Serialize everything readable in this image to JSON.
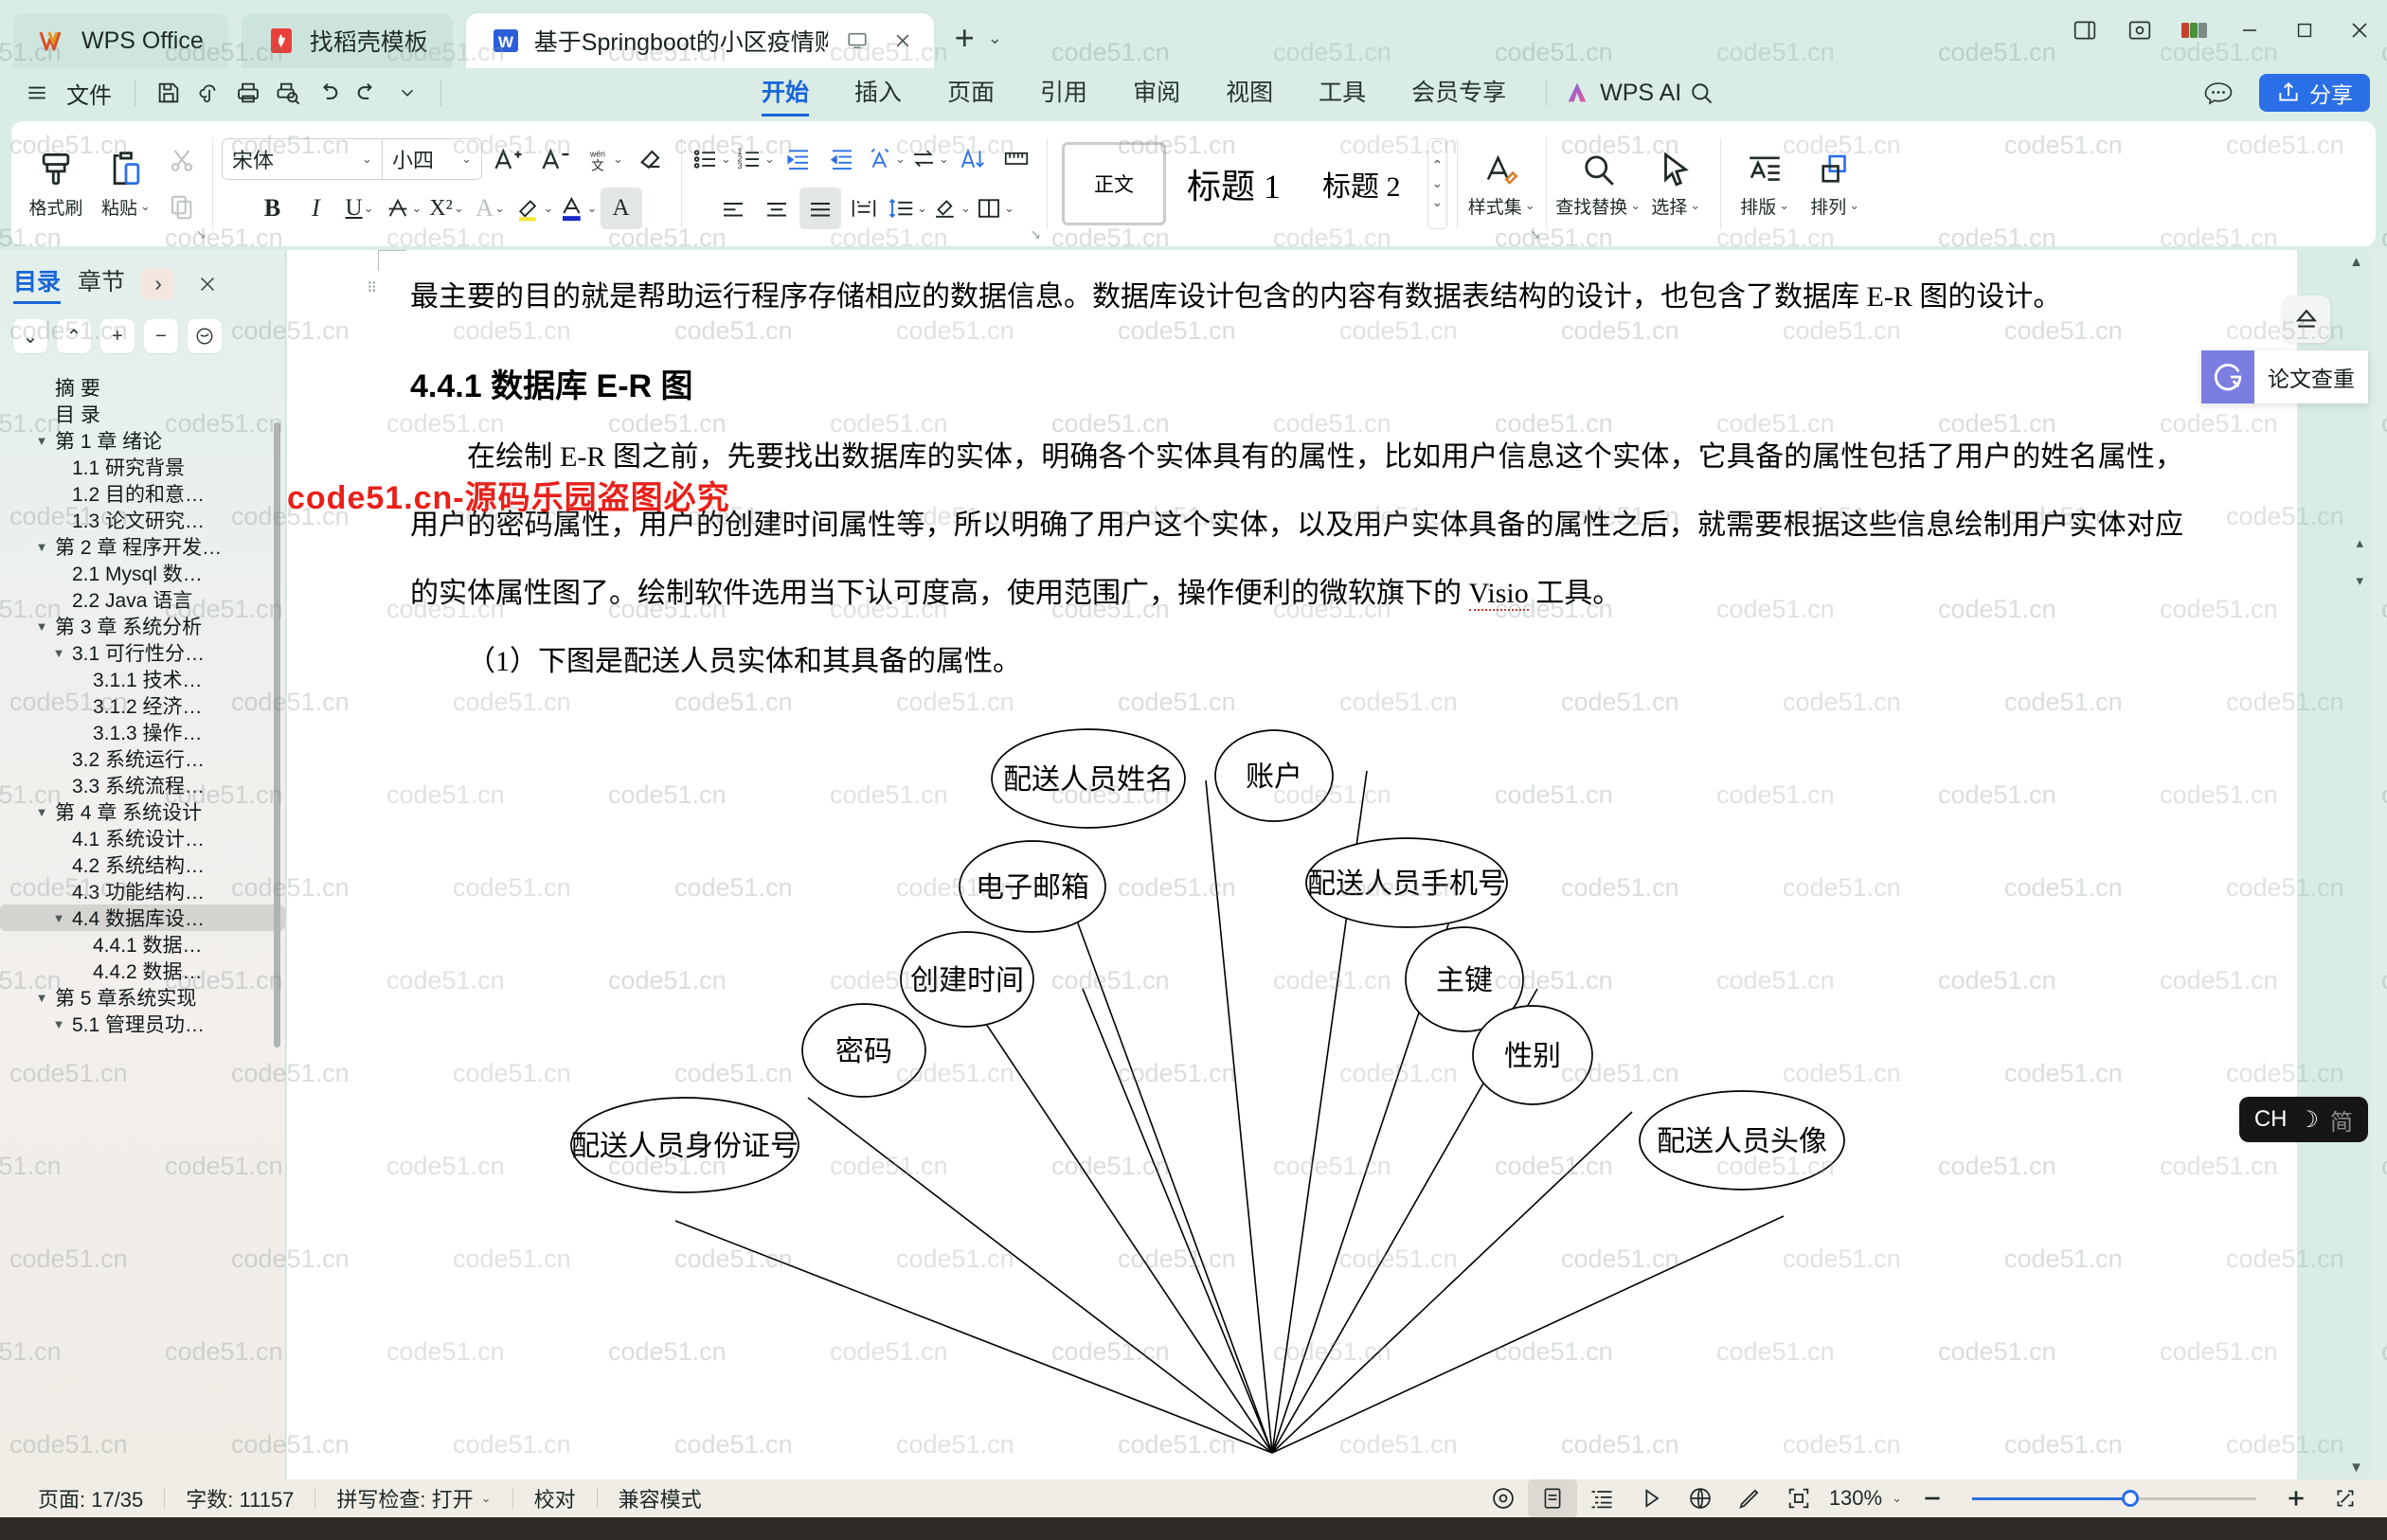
{
  "window": {
    "tabs": [
      {
        "name": "WPS Office",
        "icon": "wps-logo-icon"
      },
      {
        "name": "找稻壳模板",
        "icon": "docer-icon"
      },
      {
        "name": "基于Springboot的小区疫情购",
        "icon": "word-doc-icon"
      }
    ],
    "new_tab_icon": "plus-icon",
    "tab_list_icon": "chevron-down-icon",
    "controls": [
      "sidebar-toggle-icon",
      "focus-mode-icon",
      "layout-icon",
      "minimize-icon",
      "maximize-icon",
      "close-icon"
    ]
  },
  "quick_access": {
    "menu_label": "文件",
    "menu_icon": "hamburger-icon",
    "buttons": [
      "save-icon",
      "cloud-sync-icon",
      "print-icon",
      "print-preview-icon",
      "undo-icon",
      "redo-icon",
      "customize-caret-icon"
    ]
  },
  "ribbon": {
    "tabs": [
      "开始",
      "插入",
      "页面",
      "引用",
      "审阅",
      "视图",
      "工具",
      "会员专享"
    ],
    "active_tab": "开始",
    "ai_label": "WPS AI",
    "search_icon": "search-icon",
    "more_icon": "more-ellipsis-icon",
    "share_label": "分享",
    "share_icon": "share-arrow-icon",
    "groups": {
      "clipboard": {
        "format_painter": "格式刷",
        "paste": "粘贴",
        "cut_icon": "scissors-icon",
        "copy_icon": "copy-icon"
      },
      "font": {
        "font_name": "宋体",
        "font_size": "小四",
        "grow_icon": "increase-font-size-icon",
        "shrink_icon": "decrease-font-size-icon",
        "pinyin_icon": "pinyin-guide-icon",
        "clear_format_icon": "clear-formatting-icon",
        "bold": "B",
        "italic": "I",
        "underline": "U",
        "strikethrough_icon": "strikethrough-icon",
        "superscript": "X²",
        "text_effects_icon": "text-effects-icon",
        "highlight_icon": "highlight-color-icon",
        "font_color_icon": "font-color-icon",
        "char_shading_icon": "character-shading-icon"
      },
      "paragraph": {
        "bullets_icon": "bullet-list-icon",
        "numbering_icon": "numbered-list-icon",
        "decrease_indent_icon": "decrease-indent-icon",
        "increase_indent_icon": "increase-indent-icon",
        "paragraph_layout_icon": "paragraph-layout-icon",
        "text_direction_icon": "text-direction-icon",
        "sort_icon": "sort-icon",
        "show_marks_icon": "show-formatting-marks-icon",
        "align_left_icon": "align-left-icon",
        "align_center_icon": "align-center-icon",
        "align_right_icon": "align-right-icon",
        "justify_icon": "justify-icon",
        "distribute_icon": "distribute-icon",
        "line_spacing_icon": "line-spacing-icon",
        "shading_icon": "paragraph-shading-icon",
        "borders_icon": "borders-icon"
      },
      "styles": {
        "items": [
          "正文",
          "标题 1",
          "标题 2"
        ],
        "selected": "正文",
        "scroll_up_icon": "scroll-up-icon",
        "scroll_down_icon": "scroll-down-icon",
        "expand_icon": "expand-gallery-icon",
        "style_set_label": "样式集",
        "style_set_icon": "style-set-icon"
      },
      "editing": {
        "find_replace_label": "查找替换",
        "find_replace_icon": "search-icon",
        "select_label": "选择",
        "select_icon": "cursor-arrow-icon"
      },
      "arrange": {
        "typeset_label": "排版",
        "typeset_icon": "typeset-icon",
        "arrange_label": "排列",
        "arrange_icon": "arrange-shapes-icon"
      }
    }
  },
  "sidebar": {
    "tabs": [
      "目录",
      "章节"
    ],
    "active_tab": "目录",
    "expand_icon": "chevron-right-icon",
    "close_icon": "close-icon",
    "tools": [
      "collapse-down-icon",
      "collapse-up-icon",
      "expand-all-icon",
      "collapse-all-icon",
      "settings-circle-icon"
    ],
    "toc": [
      {
        "label": "摘  要",
        "level": 0,
        "caret": "",
        "selected": false
      },
      {
        "label": "目  录",
        "level": 0,
        "caret": "",
        "selected": false
      },
      {
        "label": "第 1 章 绪论",
        "level": 0,
        "caret": "▼",
        "selected": false
      },
      {
        "label": "1.1 研究背景",
        "level": 1,
        "caret": "",
        "selected": false
      },
      {
        "label": "1.2 目的和意…",
        "level": 1,
        "caret": "",
        "selected": false
      },
      {
        "label": "1.3 论文研究…",
        "level": 1,
        "caret": "",
        "selected": false
      },
      {
        "label": "第 2 章 程序开发…",
        "level": 0,
        "caret": "▼",
        "selected": false
      },
      {
        "label": "2.1 Mysql 数…",
        "level": 1,
        "caret": "",
        "selected": false
      },
      {
        "label": "2.2 Java 语言",
        "level": 1,
        "caret": "",
        "selected": false
      },
      {
        "label": "第 3 章 系统分析",
        "level": 0,
        "caret": "▼",
        "selected": false
      },
      {
        "label": "3.1 可行性分…",
        "level": 1,
        "caret": "▼",
        "selected": false
      },
      {
        "label": "3.1.1 技术…",
        "level": 2,
        "caret": "",
        "selected": false
      },
      {
        "label": "3.1.2 经济…",
        "level": 2,
        "caret": "",
        "selected": false
      },
      {
        "label": "3.1.3 操作…",
        "level": 2,
        "caret": "",
        "selected": false
      },
      {
        "label": "3.2 系统运行…",
        "level": 1,
        "caret": "",
        "selected": false
      },
      {
        "label": "3.3 系统流程…",
        "level": 1,
        "caret": "",
        "selected": false
      },
      {
        "label": "第 4 章 系统设计",
        "level": 0,
        "caret": "▼",
        "selected": false
      },
      {
        "label": "4.1 系统设计…",
        "level": 1,
        "caret": "",
        "selected": false
      },
      {
        "label": "4.2 系统结构…",
        "level": 1,
        "caret": "",
        "selected": false
      },
      {
        "label": "4.3 功能结构…",
        "level": 1,
        "caret": "",
        "selected": false
      },
      {
        "label": "4.4 数据库设…",
        "level": 1,
        "caret": "▼",
        "selected": true
      },
      {
        "label": "4.4.1 数据…",
        "level": 2,
        "caret": "",
        "selected": false
      },
      {
        "label": "4.4.2 数据…",
        "level": 2,
        "caret": "",
        "selected": false
      },
      {
        "label": "第 5 章系统实现",
        "level": 0,
        "caret": "▼",
        "selected": false
      },
      {
        "label": "5.1 管理员功…",
        "level": 1,
        "caret": "▼",
        "selected": false
      }
    ]
  },
  "document": {
    "paragraphs": [
      "最主要的目的就是帮助运行程序存储相应的数据信息。数据库设计包含的内容有数据表结构的设计，也包含了数据库 E-R 图的设计。"
    ],
    "heading": "4.4.1 数据库 E-R 图",
    "body_part_a": "在绘制 E-R 图之前，先要找出数据库的实体，明确各个实体具有的属性，比如用户信息这个实体，它具备的属性包括了用户的姓名属性，用户的密码属性，用户的创建时间属性等，所以明确了用户这个实体，以及用户实体具备的属性之后，就需要根据这些信息绘制用户实体对应的实体属性图了。绘制软件选用当下认可度高，使用范围广，操作便利的微软旗下的 ",
    "body_visio": "Visio",
    "body_part_b": " 工具。",
    "figure_caption": "（1）下图是配送人员实体和其具备的属性。",
    "watermark_red": "code51.cn-源码乐园盗图必究",
    "watermark_text": "code51.cn"
  },
  "er_diagram": {
    "type": "entity-attribute",
    "attributes": [
      "配送人员姓名",
      "账户",
      "电子邮箱",
      "配送人员手机号",
      "创建时间",
      "主键",
      "密码",
      "性别",
      "配送人员身份证号",
      "配送人员头像"
    ]
  },
  "floating": {
    "eject_icon": "eject-icon",
    "paper_check_label": "论文查重",
    "paper_check_icon": "paper-check-icon",
    "ime": {
      "lang": "CH",
      "mode_icon": "moon-icon",
      "script": "简"
    }
  },
  "status_bar": {
    "page_label": "页面: 17/35",
    "word_count_label": "字数: 11157",
    "spellcheck_label": "拼写检查: 打开",
    "proofread_label": "校对",
    "compat_label": "兼容模式",
    "view_icons": [
      "read-view-icon",
      "page-view-icon",
      "outline-view-icon",
      "play-view-icon",
      "web-view-icon",
      "pen-icon",
      "fit-icon"
    ],
    "zoom_level": "130%",
    "zoom_out_icon": "minus-icon",
    "zoom_in_icon": "plus-icon",
    "fullscreen_icon": "fullscreen-icon"
  },
  "colors": {
    "accent": "#1765d8",
    "share_blue": "#2b6fe6",
    "chrome": "#d9ece6",
    "status_bg": "#f0ece6",
    "watermark_red": "#e8201a"
  }
}
